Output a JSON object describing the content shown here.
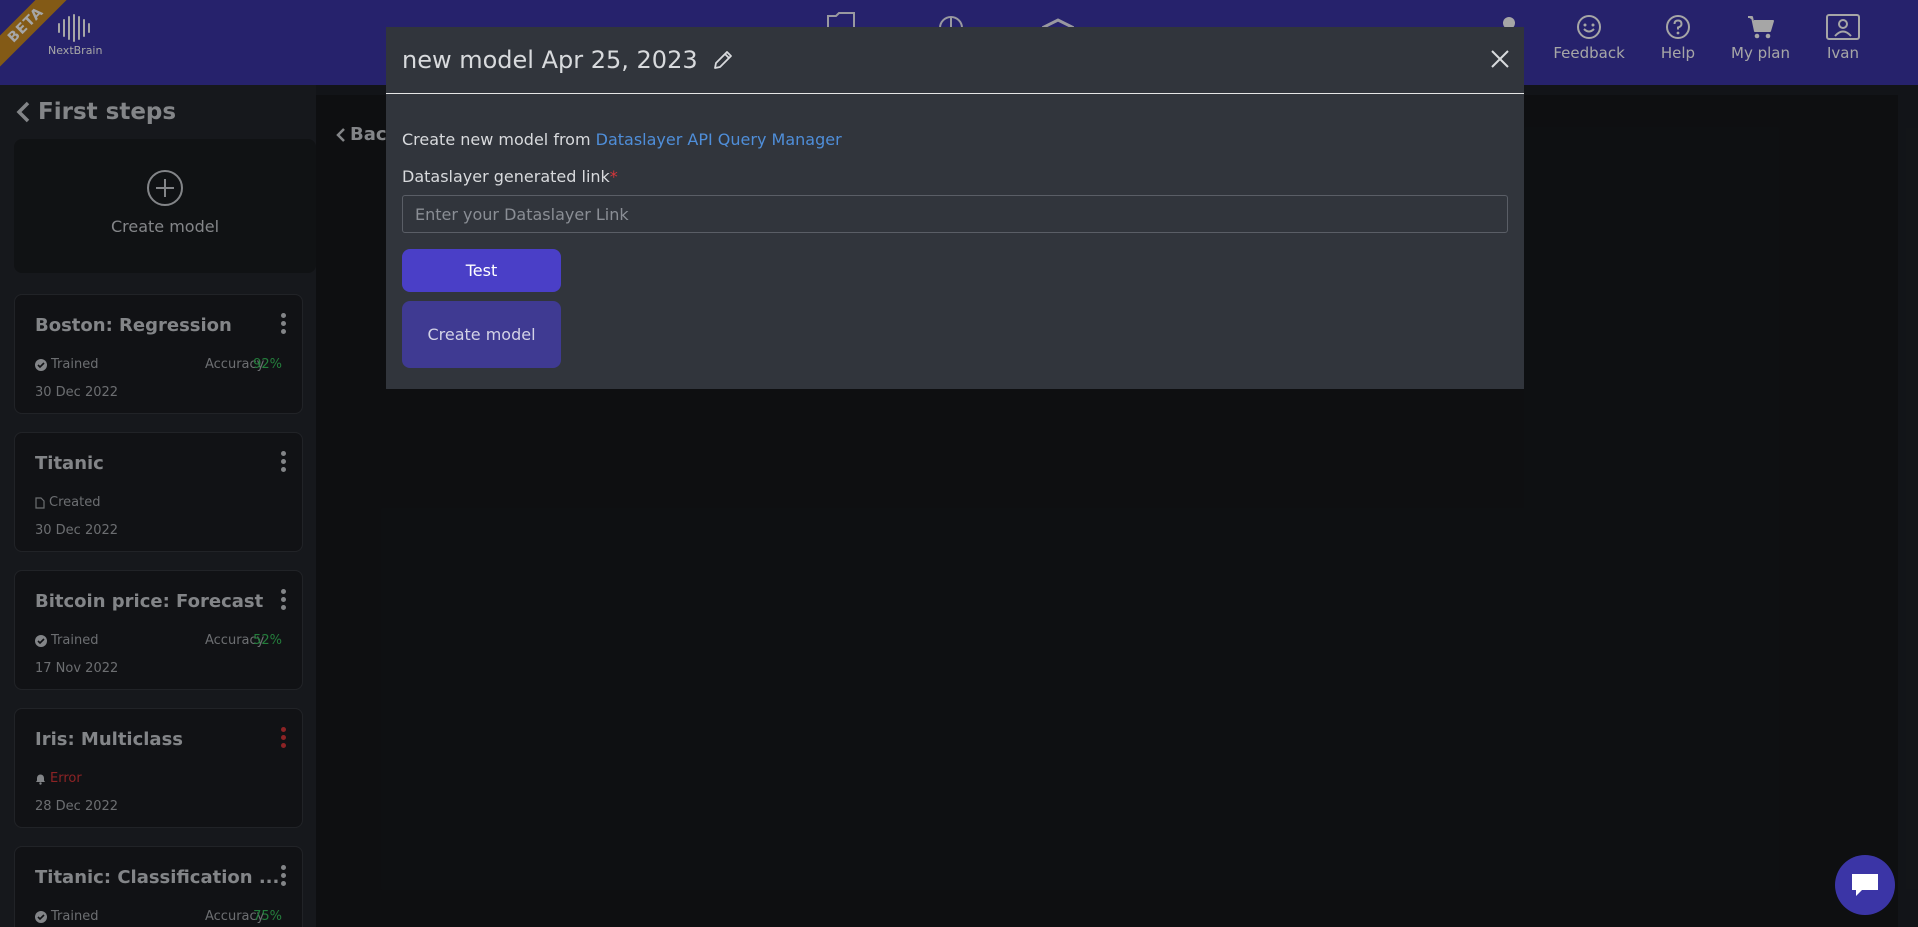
{
  "brand": {
    "ribbon": "BETA",
    "logo_text": "NextBrain"
  },
  "topnav": {
    "partial_label": "n",
    "items": [
      {
        "label": "Feedback",
        "icon": "smile-icon"
      },
      {
        "label": "Help",
        "icon": "question-circle-icon"
      },
      {
        "label": "My plan",
        "icon": "cart-icon"
      },
      {
        "label": "Ivan",
        "icon": "user-card-icon"
      }
    ]
  },
  "sidebar": {
    "title": "First steps",
    "create_label": "Create model",
    "cards": [
      {
        "title": "Boston: Regression",
        "status": "Trained",
        "accuracy_label": "Accuracy",
        "accuracy": "92%",
        "date": "30 Dec 2022"
      },
      {
        "title": "Titanic",
        "status": "Created",
        "date": "30 Dec 2022"
      },
      {
        "title": "Bitcoin price: Forecast",
        "status": "Trained",
        "accuracy_label": "Accuracy",
        "accuracy": "52%",
        "date": "17 Nov 2022"
      },
      {
        "title": "Iris: Multiclass",
        "status": "Error",
        "date": "28 Dec 2022"
      },
      {
        "title": "Titanic: Classification ...",
        "status": "Trained",
        "accuracy_label": "Accuracy",
        "accuracy": "75%"
      }
    ]
  },
  "main": {
    "back_label": "Bac"
  },
  "modal": {
    "title": "new model Apr 25, 2023",
    "create_from_text": "Create new model from ",
    "create_from_link": "Dataslayer API Query Manager",
    "field_label": "Dataslayer generated link",
    "required_mark": "*",
    "input_placeholder": "Enter your Dataslayer Link",
    "input_value": "",
    "test_button": "Test",
    "create_button": "Create model"
  },
  "colors": {
    "topbar": "#3b35a6",
    "accent": "#4a3fc7",
    "link": "#4f8ed9",
    "success": "#38c05c",
    "error": "#d8363a",
    "beta": "#c98a22"
  }
}
